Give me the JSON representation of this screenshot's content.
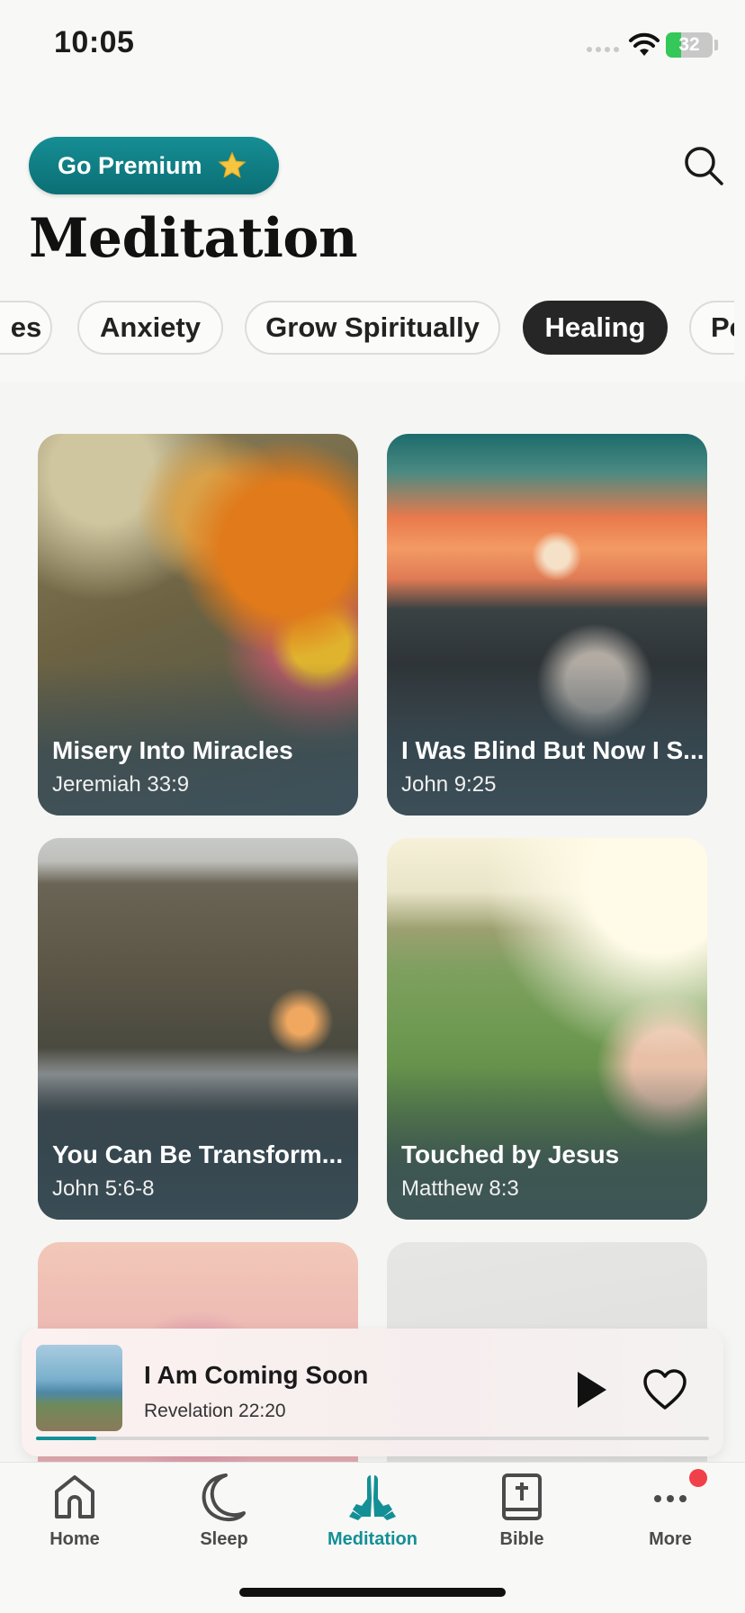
{
  "status_bar": {
    "time": "10:05",
    "battery": "32"
  },
  "header": {
    "premium_label": "Go Premium",
    "title": "Meditation"
  },
  "categories": [
    {
      "label": "es"
    },
    {
      "label": "Anxiety"
    },
    {
      "label": "Grow Spiritually"
    },
    {
      "label": "Healing",
      "active": true
    },
    {
      "label": "Pe"
    }
  ],
  "cards": [
    {
      "title": "Misery Into Miracles",
      "verse": "Jeremiah 33:9"
    },
    {
      "title": "I Was Blind But Now I S...",
      "verse": "John 9:25"
    },
    {
      "title": "You Can Be Transform...",
      "verse": "John 5:6-8"
    },
    {
      "title": "Touched by Jesus",
      "verse": "Matthew 8:3"
    },
    {
      "title": "",
      "verse": ""
    },
    {
      "title": "",
      "verse": ""
    }
  ],
  "now_playing": {
    "title": "I Am Coming Soon",
    "verse": "Revelation 22:20",
    "progress": 0.09
  },
  "tabs": [
    {
      "label": "Home",
      "icon": "home-icon"
    },
    {
      "label": "Sleep",
      "icon": "moon-icon"
    },
    {
      "label": "Meditation",
      "icon": "praying-hands-icon",
      "active": true
    },
    {
      "label": "Bible",
      "icon": "bible-icon"
    },
    {
      "label": "More",
      "icon": "more-icon"
    }
  ],
  "colors": {
    "accent": "#129199",
    "active_chip": "#262626",
    "notification": "#f0404a"
  }
}
